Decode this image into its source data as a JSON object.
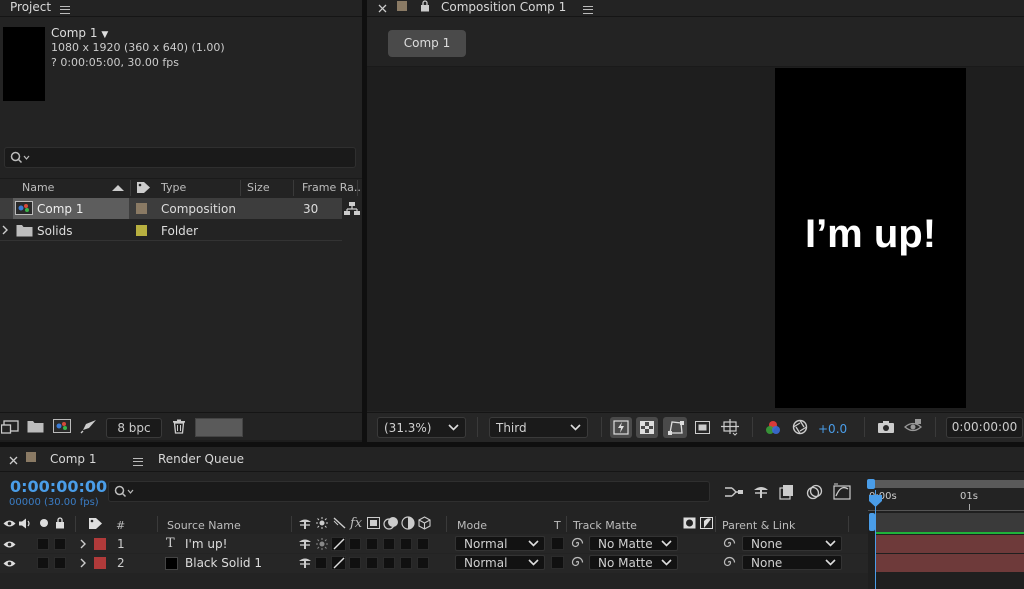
{
  "project": {
    "title": "Project",
    "comp_name": "Comp 1",
    "comp_dims": "1080 x 1920  (360 x 640) (1.00)",
    "comp_duration": "? 0:00:05:00, 30.00 fps",
    "columns": {
      "name": "Name",
      "type": "Type",
      "size": "Size",
      "frame_rate": "Frame Ra..."
    },
    "items": [
      {
        "name": "Comp 1",
        "type": "Composition",
        "frame_rate": "30",
        "swatch": "#8a7a64"
      },
      {
        "name": "Solids",
        "type": "Folder",
        "frame_rate": "",
        "swatch": "#b8b040"
      }
    ],
    "bpc": "8 bpc"
  },
  "viewer": {
    "tab_title": "Composition Comp 1",
    "comp_tab": "Comp 1",
    "preview_text": "I’m up!",
    "zoom": "(31.3%)",
    "grid": "Third",
    "exposure": "+0.0",
    "timecode": "0:00:00:00"
  },
  "timeline": {
    "tab": "Comp 1",
    "render_queue": "Render Queue",
    "timecode": "0:00:00:00",
    "frame_info": "00000 (30.00 fps)",
    "ruler": [
      "0:00s",
      "01s"
    ],
    "columns": {
      "num": "#",
      "source_name": "Source Name",
      "fx": "fx",
      "mode": "Mode",
      "t": "T",
      "track_matte": "Track Matte",
      "parent": "Parent & Link"
    },
    "layers": [
      {
        "num": "1",
        "name": "I'm up!",
        "type_glyph": "T",
        "mode": "Normal",
        "matte": "No Matte",
        "parent": "None",
        "label_color": "#b03a3a"
      },
      {
        "num": "2",
        "name": "Black Solid 1",
        "type_glyph": "",
        "mode": "Normal",
        "matte": "No Matte",
        "parent": "None",
        "label_color": "#b03a3a"
      }
    ]
  },
  "colors": {
    "accent": "#2d8ceb",
    "green_bar": "#1fb33a",
    "layer_bar": "#6e3a3a"
  }
}
